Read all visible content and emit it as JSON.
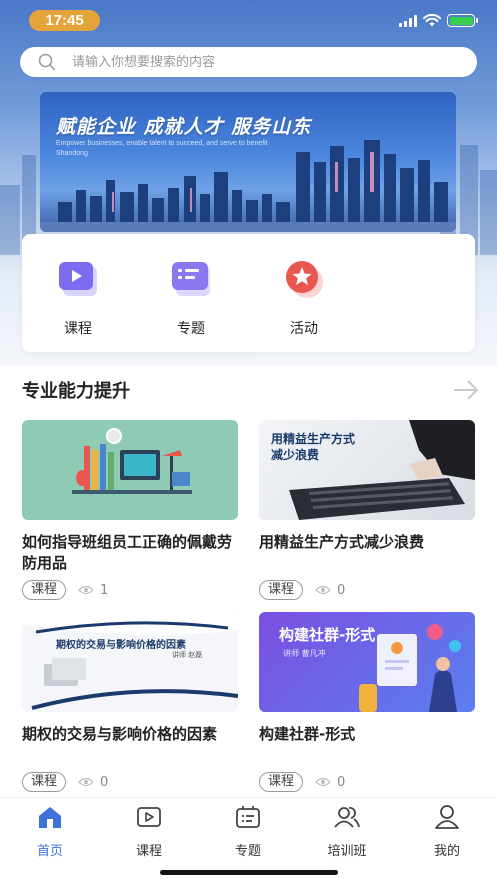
{
  "status_bar": {
    "time": "17:45",
    "icons": [
      "signal-icon",
      "wifi-icon",
      "battery-charging-icon"
    ],
    "time_badge_color": "#e5a43a"
  },
  "search": {
    "placeholder": "请输入你想要搜索的内容",
    "icon": "search-icon"
  },
  "banner": {
    "slogan": "赋能企业 成就人才 服务山东",
    "subtitle": "Empower businesses, enable talent to succeed, and serve to benefit Shandong"
  },
  "quick_menu": [
    {
      "label": "课程",
      "icon": "video-play-icon",
      "color": "#7b6cf0"
    },
    {
      "label": "专题",
      "icon": "topic-list-icon",
      "color": "#8a78f2"
    },
    {
      "label": "活动",
      "icon": "star-badge-icon",
      "color": "#e9574f"
    }
  ],
  "section": {
    "title": "专业能力提升",
    "more_icon": "arrow-right-icon"
  },
  "courses": [
    {
      "title": "如何指导班组员工正确的佩戴劳防用品",
      "tag": "课程",
      "views": "1",
      "thumb_color": "#8fcbb4"
    },
    {
      "title": "用精益生产方式减少浪费",
      "tag": "课程",
      "views": "0",
      "thumb_text_1": "用精益生产方式",
      "thumb_text_2": "减少浪费"
    },
    {
      "title": "期权的交易与影响价格的因素",
      "tag": "课程",
      "views": "0",
      "thumb_text": "期权的交易与影响价格的因素",
      "thumb_lecturer": "讲师  赵磊"
    },
    {
      "title": "构建社群-形式",
      "tag": "课程",
      "views": "0",
      "thumb_text": "构建社群-形式",
      "thumb_lecturer": "讲师  曹凡冲"
    }
  ],
  "tabbar": [
    {
      "label": "首页",
      "icon": "home-icon",
      "active": true
    },
    {
      "label": "课程",
      "icon": "video-play-icon",
      "active": false
    },
    {
      "label": "专题",
      "icon": "topic-list-icon",
      "active": false
    },
    {
      "label": "培训班",
      "icon": "group-icon",
      "active": false
    },
    {
      "label": "我的",
      "icon": "user-icon",
      "active": false
    }
  ],
  "colors": {
    "accent": "#3d72d9",
    "text": "#222222",
    "muted": "#888888"
  }
}
